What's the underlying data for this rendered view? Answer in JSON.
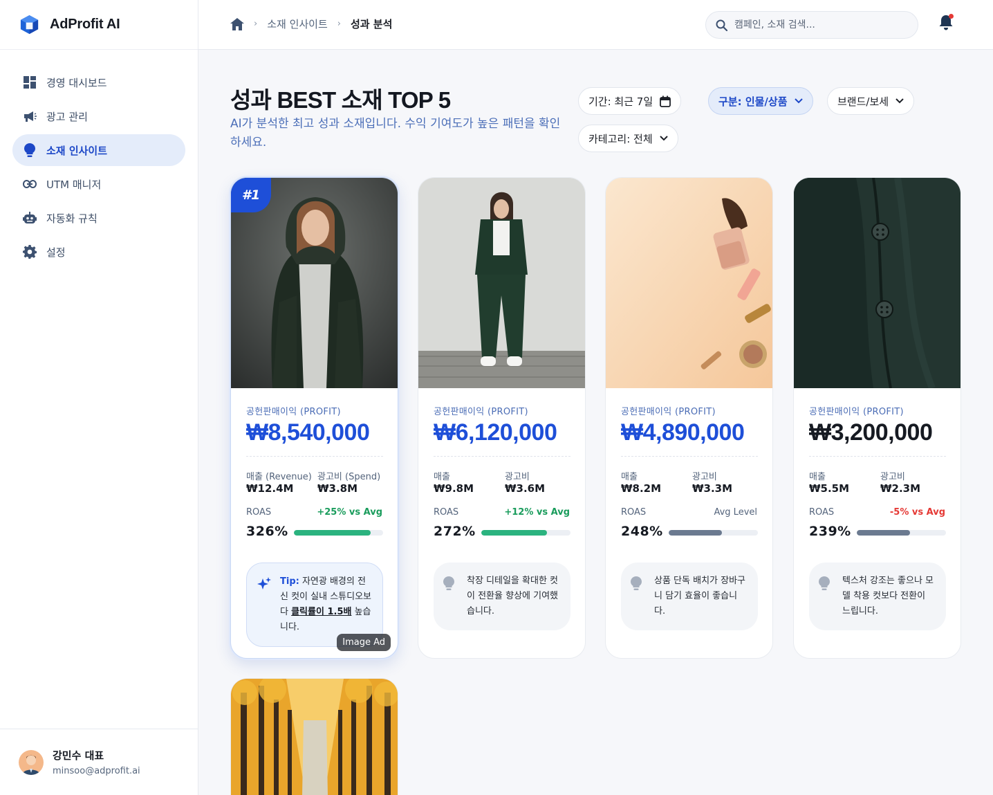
{
  "app": {
    "name": "AdProfit AI"
  },
  "sidebar": {
    "items": [
      {
        "label": "경영 대시보드",
        "icon": "dashboard-icon"
      },
      {
        "label": "광고 관리",
        "icon": "megaphone-icon"
      },
      {
        "label": "소재 인사이트",
        "icon": "lightbulb-icon",
        "active": true
      },
      {
        "label": "UTM 매니저",
        "icon": "link-icon"
      },
      {
        "label": "자동화 규칙",
        "icon": "robot-icon"
      },
      {
        "label": "설정",
        "icon": "gear-icon"
      }
    ]
  },
  "profile": {
    "name": "강민수 대표",
    "email": "minsoo@adprofit.ai"
  },
  "breadcrumb": {
    "section": "소재 인사이트",
    "current": "성과 분석"
  },
  "search": {
    "placeholder": "캠페인, 소재 검색..."
  },
  "page": {
    "title": "성과 BEST 소재 TOP 5",
    "subtitle": "AI가 분석한 최고 성과 소재입니다. 수익 기여도가 높은 패턴을 확인하세요."
  },
  "filters": {
    "period": "기간: 최근 7일",
    "type": "구분: 인물/상품",
    "brand": "브랜드/보세",
    "category": "카테고리: 전체"
  },
  "cards": [
    {
      "rank": "#1",
      "tag": "Image Ad",
      "profit_label": "공헌판매이익 (PROFIT)",
      "profit": "₩8,540,000",
      "m1_label": "매출 (Revenue)",
      "m1": "₩12.4M",
      "m2_label": "광고비 (Spend)",
      "m2": "₩3.8M",
      "roas_label": "ROAS",
      "roas_cmp": "+25% vs Avg",
      "roas": "326%",
      "roas_bar": 0.86,
      "bar_color": "#2bb37f",
      "cmp_color": "#1a9c5c",
      "tip_prefix": "Tip:",
      "tip_a": " 자연광 배경의 전신 컷이 실내 스튜디오보다 ",
      "tip_b": "클릭률이 1.5배",
      "tip_c": " 높습니다."
    },
    {
      "profit_label": "공헌판매이익 (PROFIT)",
      "profit": "₩6,120,000",
      "m1_label": "매출",
      "m1": "₩9.8M",
      "m2_label": "광고비",
      "m2": "₩3.6M",
      "roas_label": "ROAS",
      "roas_cmp": "+12% vs Avg",
      "roas": "272%",
      "roas_bar": 0.74,
      "bar_color": "#2bb37f",
      "cmp_color": "#1a9c5c",
      "tip": "착장 디테일을 확대한 컷이 전환율 향상에 기여했습니다."
    },
    {
      "profit_label": "공헌판매이익 (PROFIT)",
      "profit": "₩4,890,000",
      "m1_label": "매출",
      "m1": "₩8.2M",
      "m2_label": "광고비",
      "m2": "₩3.3M",
      "roas_label": "ROAS",
      "roas_cmp": "Avg Level",
      "roas": "248%",
      "roas_bar": 0.6,
      "bar_color": "#6b7a90",
      "cmp_color": "#53637b",
      "tip": "상품 단독 배치가 장바구니 담기 효율이 좋습니다."
    },
    {
      "profit_label": "공헌판매이익 (PROFIT)",
      "profit": "₩3,200,000",
      "m1_label": "매출",
      "m1": "₩5.5M",
      "m2_label": "광고비",
      "m2": "₩2.3M",
      "roas_label": "ROAS",
      "roas_cmp": "-5% vs Avg",
      "roas": "239%",
      "roas_bar": 0.6,
      "bar_color": "#6b7a90",
      "cmp_color": "#e53935",
      "tip": "텍스처 강조는 좋으나 모델 착용 컷보다 전환이 느립니다."
    }
  ],
  "colors": {
    "accent": "#1e4fd8",
    "positive": "#1a9c5c",
    "negative": "#e53935"
  }
}
